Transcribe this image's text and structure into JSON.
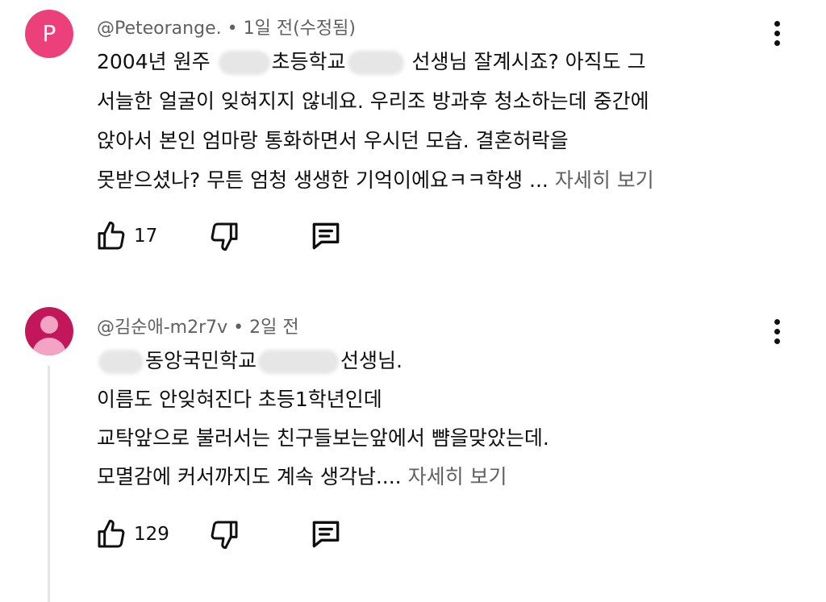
{
  "comments": [
    {
      "avatar_letter": "P",
      "author": "@Peteorange.",
      "sep": "•",
      "time": "1일 전(수정됨)",
      "lines": [
        {
          "a": "2004년 원주 ",
          "b": "초등학교",
          "c": " 선생님 잘계시죠? 아직도 그"
        },
        "서늘한 얼굴이 잊혀지지 않네요. 우리조 방과후 청소하는데 중간에",
        "앉아서 본인 엄마랑 통화하면서 우시던 모습. 결혼허락을",
        "못받으셨나? 무튼 엄청 생생한 기억이에요ㅋㅋ학생 ..."
      ],
      "more": "자세히 보기",
      "likes": "17"
    },
    {
      "author": "@김순애-m2r7v",
      "sep": "•",
      "time": "2일 전",
      "lines": [
        {
          "a": "동앙국민학교",
          "b": "선생님."
        },
        "이름도 안잊혀진다 초등1학년인데",
        "교탁앞으로 불러서는 친구들보는앞에서 뺨을맞았는데.",
        "모멸감에 커서까지도 계속 생각남...."
      ],
      "more": "자세히 보기",
      "likes": "129"
    }
  ],
  "icons": {
    "like": "thumbs-up-icon",
    "dislike": "thumbs-down-icon",
    "reply": "reply-comment-icon",
    "menu": "more-vert-icon"
  },
  "colors": {
    "avatar_p": "#ec407a",
    "avatar_person": "#c2185b",
    "meta_text": "#606060"
  }
}
